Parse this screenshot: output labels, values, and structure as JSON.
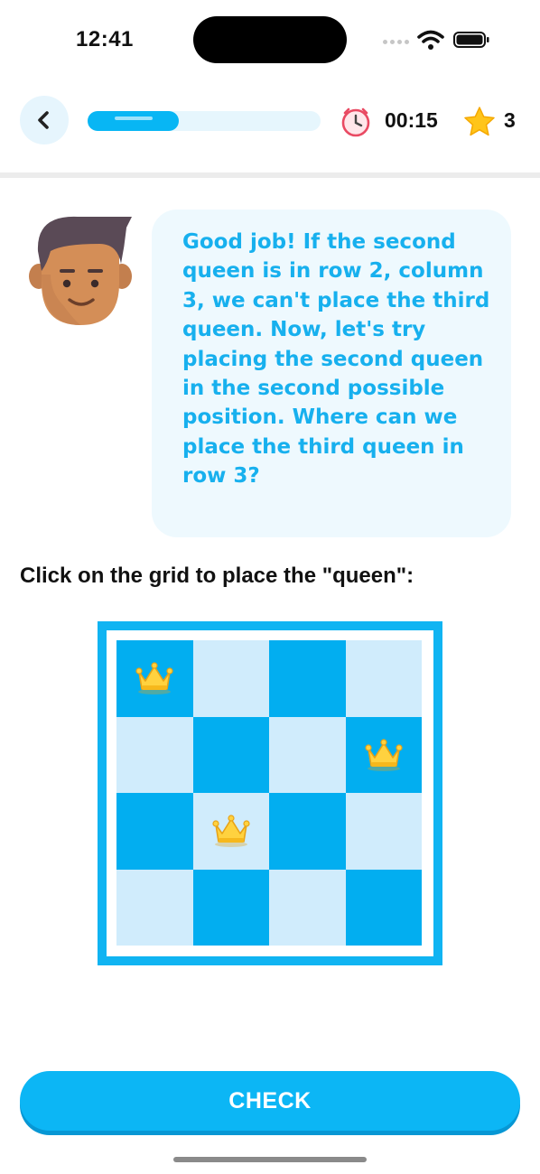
{
  "status_bar": {
    "time": "12:41",
    "icons": [
      "signal-dots-icon",
      "wifi-icon",
      "battery-icon"
    ]
  },
  "header": {
    "back_icon": "chevron-left-icon",
    "progress_fraction": 0.39,
    "timer_icon": "alarm-clock-icon",
    "timer": "00:15",
    "star_icon": "star-icon",
    "stars": "3"
  },
  "tutor": {
    "message": "Good job! If the second queen is in row 2, column 3, we can't place the third queen. Now, let's try placing the second queen in the second possible position. Where can we place the third queen in row 3?"
  },
  "instruction": "Click on the grid to place the \"queen\":",
  "board": {
    "size": 4,
    "queens": [
      {
        "row": 1,
        "col": 1
      },
      {
        "row": 2,
        "col": 4
      },
      {
        "row": 3,
        "col": 2
      }
    ],
    "piece_icon": "crown-icon",
    "colors": {
      "frame": "#10b4f2",
      "dark": "#02aef0",
      "light": "#d0ecfc"
    }
  },
  "actions": {
    "check_label": "CHECK"
  },
  "colors": {
    "accent": "#0cb6f5",
    "bubble_background": "#eef9fe",
    "bubble_text": "#17b0ee"
  }
}
